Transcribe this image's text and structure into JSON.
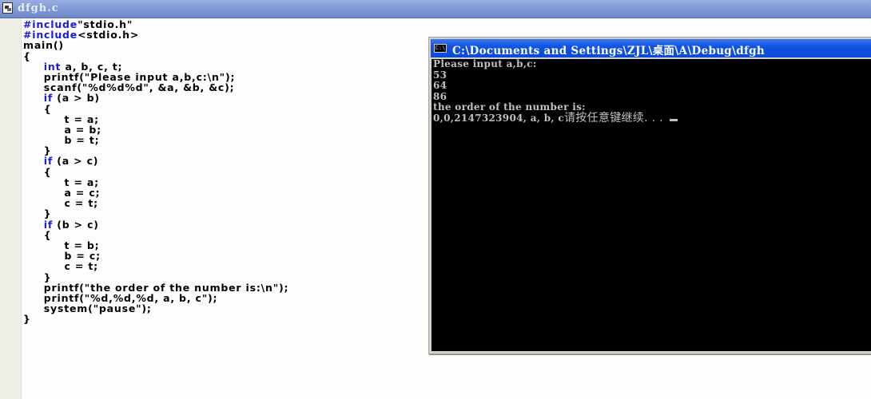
{
  "editor_window": {
    "title": "dfgh.c",
    "icon": "document-icon",
    "code_lines": [
      {
        "kw": "#include",
        "text": "\"stdio.h\""
      },
      {
        "kw": "#include",
        "text": "<stdio.h>"
      },
      {
        "kw": "",
        "text": "main()"
      },
      {
        "kw": "",
        "text": "{"
      },
      {
        "indent": "     ",
        "kw": "int",
        "text": " a, b, c, t;"
      },
      {
        "indent": "     ",
        "kw": "",
        "text": "printf(\"Please input a,b,c:\\n\");"
      },
      {
        "indent": "     ",
        "kw": "",
        "text": "scanf(\"%d%d%d\", &a, &b, &c);"
      },
      {
        "indent": "     ",
        "kw": "if",
        "text": " (a > b)"
      },
      {
        "indent": "     ",
        "kw": "",
        "text": "{"
      },
      {
        "indent": "          ",
        "kw": "",
        "text": "t = a;"
      },
      {
        "indent": "          ",
        "kw": "",
        "text": "a = b;"
      },
      {
        "indent": "          ",
        "kw": "",
        "text": "b = t;"
      },
      {
        "indent": "     ",
        "kw": "",
        "text": "}"
      },
      {
        "indent": "     ",
        "kw": "if",
        "text": " (a > c)"
      },
      {
        "indent": "     ",
        "kw": "",
        "text": "{"
      },
      {
        "indent": "          ",
        "kw": "",
        "text": "t = a;"
      },
      {
        "indent": "          ",
        "kw": "",
        "text": "a = c;"
      },
      {
        "indent": "          ",
        "kw": "",
        "text": "c = t;"
      },
      {
        "indent": "     ",
        "kw": "",
        "text": "}"
      },
      {
        "indent": "     ",
        "kw": "if",
        "text": " (b > c)"
      },
      {
        "indent": "     ",
        "kw": "",
        "text": "{"
      },
      {
        "indent": "          ",
        "kw": "",
        "text": "t = b;"
      },
      {
        "indent": "          ",
        "kw": "",
        "text": "b = c;"
      },
      {
        "indent": "          ",
        "kw": "",
        "text": "c = t;"
      },
      {
        "indent": "     ",
        "kw": "",
        "text": "}"
      },
      {
        "indent": "     ",
        "kw": "",
        "text": "printf(\"the order of the number is:\\n\");"
      },
      {
        "indent": "     ",
        "kw": "",
        "text": "printf(\"%d,%d,%d, a, b, c\");"
      },
      {
        "indent": "     ",
        "kw": "",
        "text": "system(\"pause\");"
      },
      {
        "kw": "",
        "text": "}"
      }
    ],
    "keyword_color": "#1a1ae0"
  },
  "console_window": {
    "icon": "cmd-icon",
    "icon_label": "C:\\",
    "title": "C:\\Documents and Settings\\ZJL\\桌面\\A\\Debug\\dfgh",
    "output_lines": [
      "Please input a,b,c:",
      "53",
      "64",
      "86",
      "the order of the number is:"
    ],
    "last_line": {
      "text": "0,0,2147323904, a, b, c",
      "prompt": "请按任意键继续. . ."
    },
    "title_color": "#0a4ad8",
    "text_color": "#c0c0c0"
  }
}
